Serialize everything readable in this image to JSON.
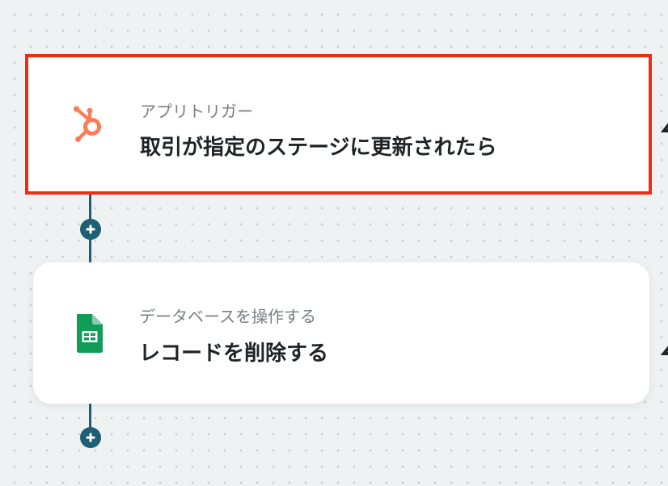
{
  "flow": {
    "steps": [
      {
        "subtitle": "アプリトリガー",
        "title": "取引が指定のステージに更新されたら",
        "icon": "hubspot-icon",
        "icon_color": "#ff7a59",
        "selected": true
      },
      {
        "subtitle": "データベースを操作する",
        "title": "レコードを削除する",
        "icon": "google-sheets-icon",
        "icon_color": "#0f9d58",
        "selected": false
      }
    ],
    "add_step_icon": "plus-icon"
  },
  "colors": {
    "connector": "#1e5f74",
    "selection_border": "#ec2d15",
    "canvas_background": "#eef2f2",
    "card_background": "#ffffff"
  }
}
